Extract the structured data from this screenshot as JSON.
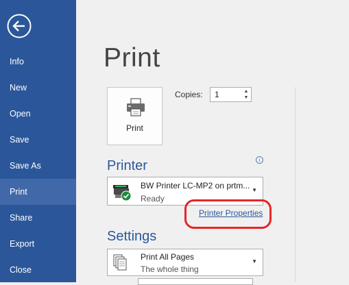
{
  "sidebar": {
    "back_label": "Back",
    "items": [
      {
        "label": "Info"
      },
      {
        "label": "New"
      },
      {
        "label": "Open"
      },
      {
        "label": "Save"
      },
      {
        "label": "Save As"
      },
      {
        "label": "Print",
        "active": true
      },
      {
        "label": "Share"
      },
      {
        "label": "Export"
      },
      {
        "label": "Close"
      }
    ]
  },
  "main": {
    "title": "Print",
    "print_button_label": "Print",
    "copies_label": "Copies:",
    "copies_value": "1"
  },
  "printer": {
    "heading": "Printer",
    "name": "BW Printer LC-MP2 on prtm...",
    "status": "Ready",
    "properties_link": "Printer Properties"
  },
  "settings": {
    "heading": "Settings",
    "pages_option": "Print All Pages",
    "pages_option_desc": "The whole thing"
  },
  "colors": {
    "accent": "#2b579a",
    "sidebar_active": "#4169a9",
    "highlight": "#e5252a"
  }
}
